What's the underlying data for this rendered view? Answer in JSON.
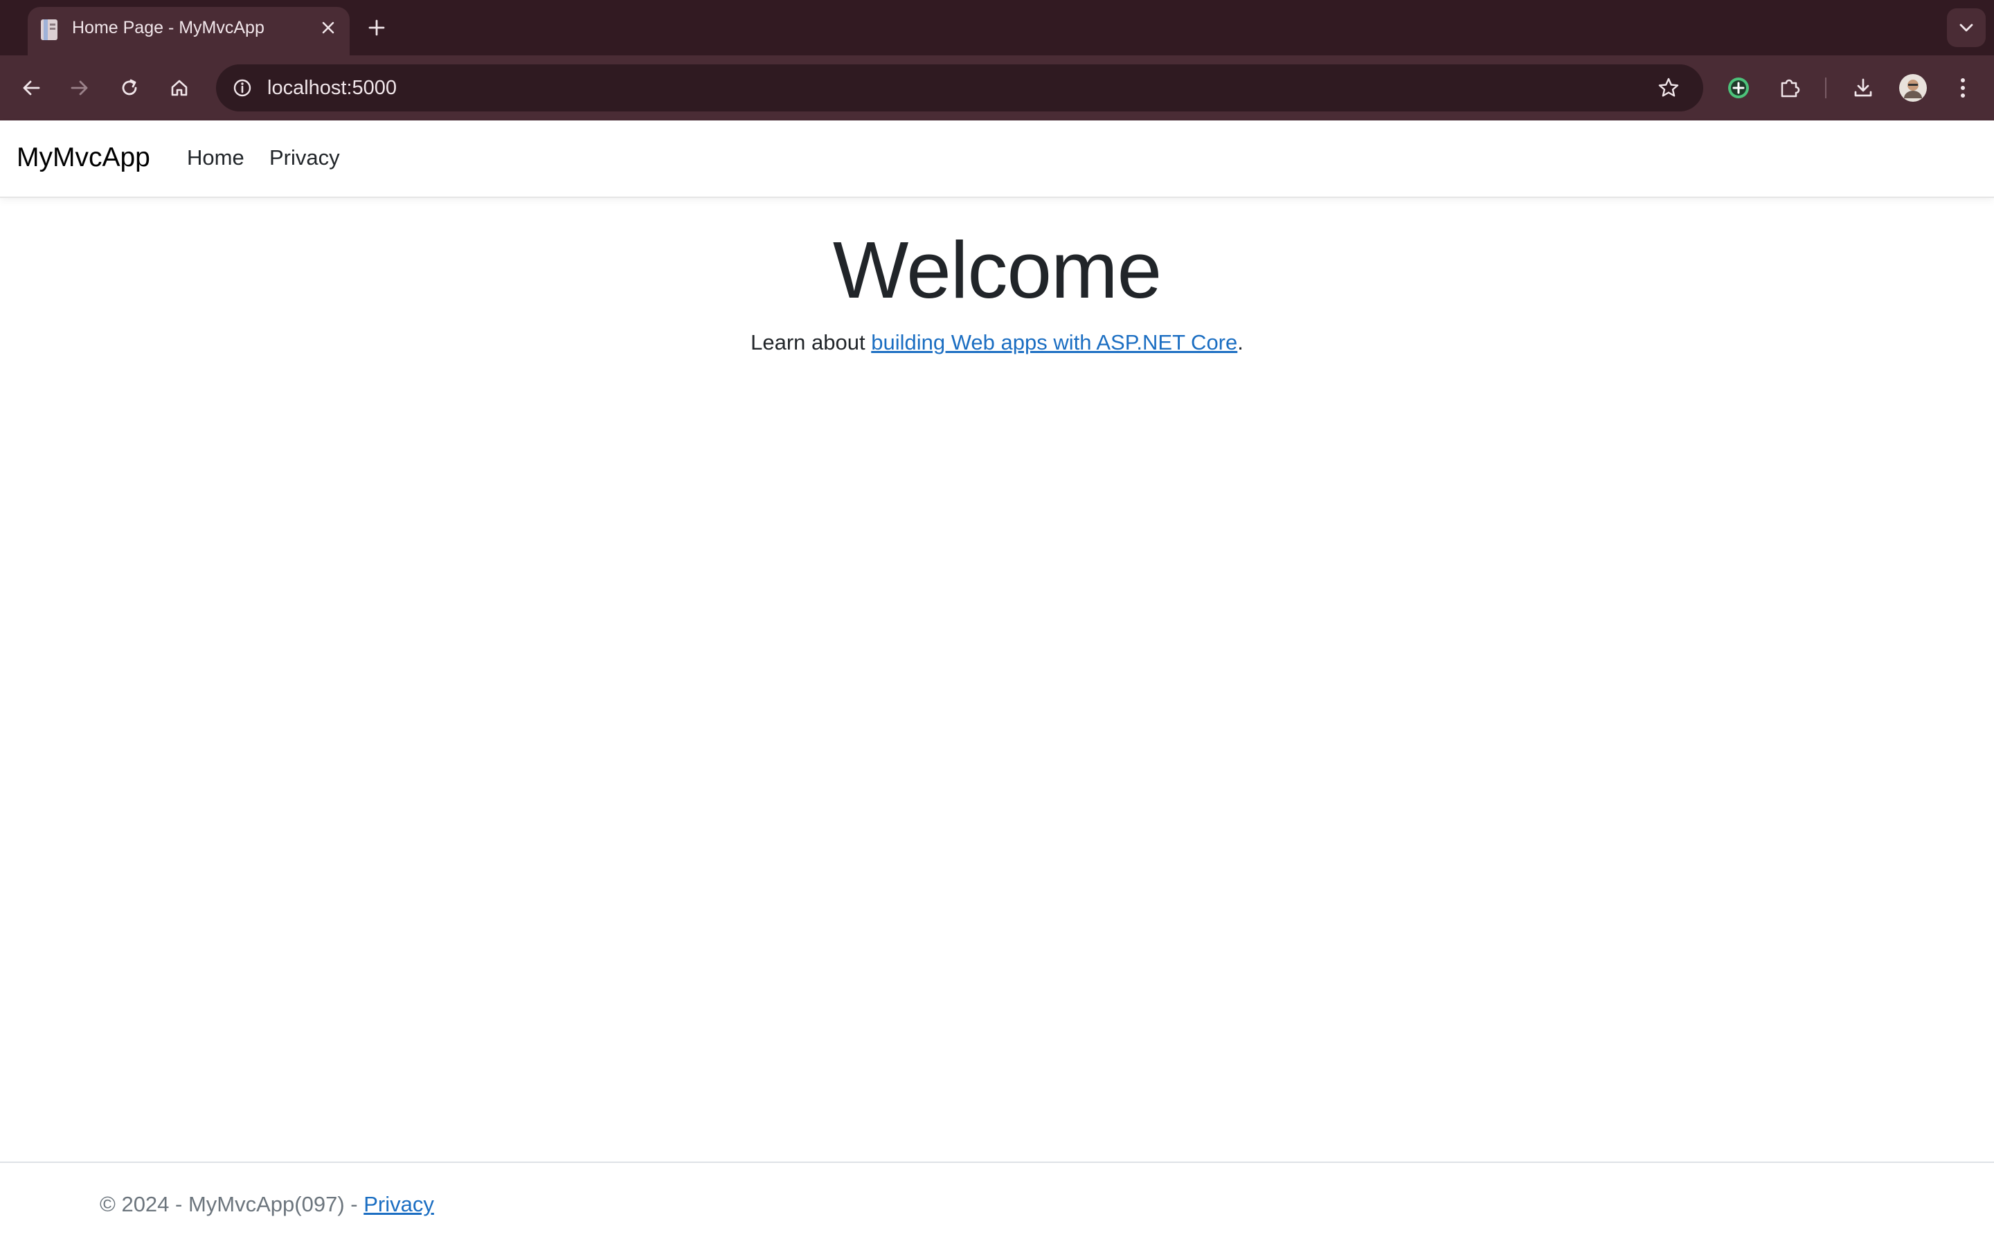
{
  "browser": {
    "tab_title": "Home Page - MyMvcApp",
    "url": "localhost:5000"
  },
  "navbar": {
    "brand": "MyMvcApp",
    "links": [
      "Home",
      "Privacy"
    ]
  },
  "main": {
    "heading": "Welcome",
    "learn_prefix": "Learn about ",
    "learn_link": "building Web apps with ASP.NET Core",
    "learn_suffix": "."
  },
  "footer": {
    "copyright": "© 2024 - MyMvcApp(097) - ",
    "privacy_link": "Privacy"
  },
  "colors": {
    "chrome_dark": "#321a22",
    "chrome_toolbar": "#4a2c35",
    "link": "#1b6ec2"
  }
}
